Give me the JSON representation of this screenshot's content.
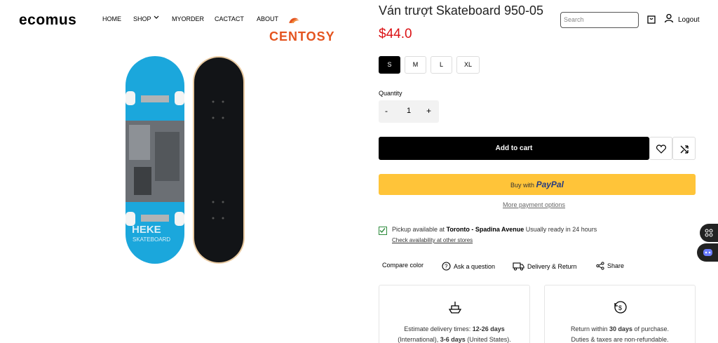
{
  "header": {
    "logo": "ecomus",
    "nav": [
      "HOME",
      "SHOP",
      "MYORDER",
      "CACTACT",
      "ABOUT"
    ],
    "brand_badge": "CENTOSY",
    "search_placeholder": "Search",
    "logout": "Logout"
  },
  "product": {
    "title": "Ván trượt Skateboard 950-05",
    "price": "$44.0",
    "sizes": [
      "S",
      "M",
      "L",
      "XL"
    ],
    "selected_size": "S",
    "quantity_label": "Quantity",
    "quantity": "1",
    "minus": "-",
    "plus": "+",
    "add_to_cart": "Add to cart",
    "paypal_prefix": "Buy with",
    "paypal_brand": "PayPal",
    "more_payment": "More payment options"
  },
  "pickup": {
    "text_prefix": "Pickup available at",
    "store": "Toronto - Spadina Avenue",
    "text_suffix": "Usually ready in 24 hours",
    "check_link": "Check availability at other stores"
  },
  "actions": [
    "Compare color",
    "Ask a question",
    "Delivery & Return",
    "Share"
  ],
  "cards": {
    "delivery": {
      "line1_prefix": "Estimate delivery times:",
      "line1_bold": "12-26 days",
      "line2_prefix": "(International),",
      "line2_bold": "3-6 days",
      "line2_suffix": "(United States)."
    },
    "return": {
      "line1_prefix": "Return within",
      "line1_bold": "30 days",
      "line1_suffix": "of purchase.",
      "line2": "Duties & taxes are non-refundable."
    }
  },
  "colors": {
    "accent_price": "#db1215",
    "paypal_yellow": "#ffc439",
    "deck_blue": "#1ba7dc",
    "brand_orange": "#e4541f"
  },
  "deck_print": "HEKE",
  "deck_print_sub": "SKATEBOARD"
}
